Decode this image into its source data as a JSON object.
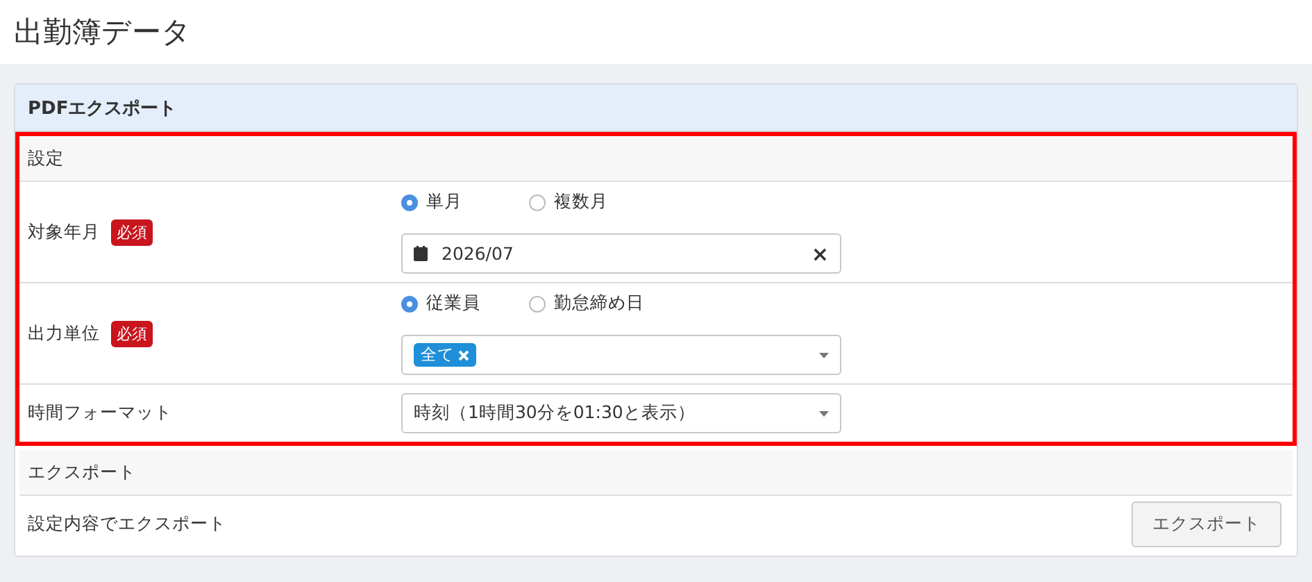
{
  "page_title": "出勤簿データ",
  "panel": {
    "title": "PDFエクスポート",
    "sections": [
      {
        "title": "設定",
        "highlighted": true,
        "rows": [
          {
            "label": "対象年月",
            "badge": "必須",
            "radios": [
              {
                "label": "単月",
                "selected": true
              },
              {
                "label": "複数月",
                "selected": false
              }
            ],
            "field": {
              "kind": "date",
              "value": "2026/07",
              "clear": "×"
            }
          },
          {
            "label": "出力単位",
            "badge": "必須",
            "radios": [
              {
                "label": "従業員",
                "selected": true
              },
              {
                "label": "勤怠締め日",
                "selected": false
              }
            ],
            "field": {
              "kind": "tags",
              "tags": [
                "全て"
              ]
            }
          },
          {
            "label": "時間フォーマット",
            "field": {
              "kind": "select",
              "value": "時刻（1時間30分を01:30と表示）"
            }
          }
        ]
      },
      {
        "title": "エクスポート",
        "highlighted": false,
        "rows": [
          {
            "label": "設定内容でエクスポート",
            "button": "エクスポート"
          }
        ]
      }
    ]
  }
}
